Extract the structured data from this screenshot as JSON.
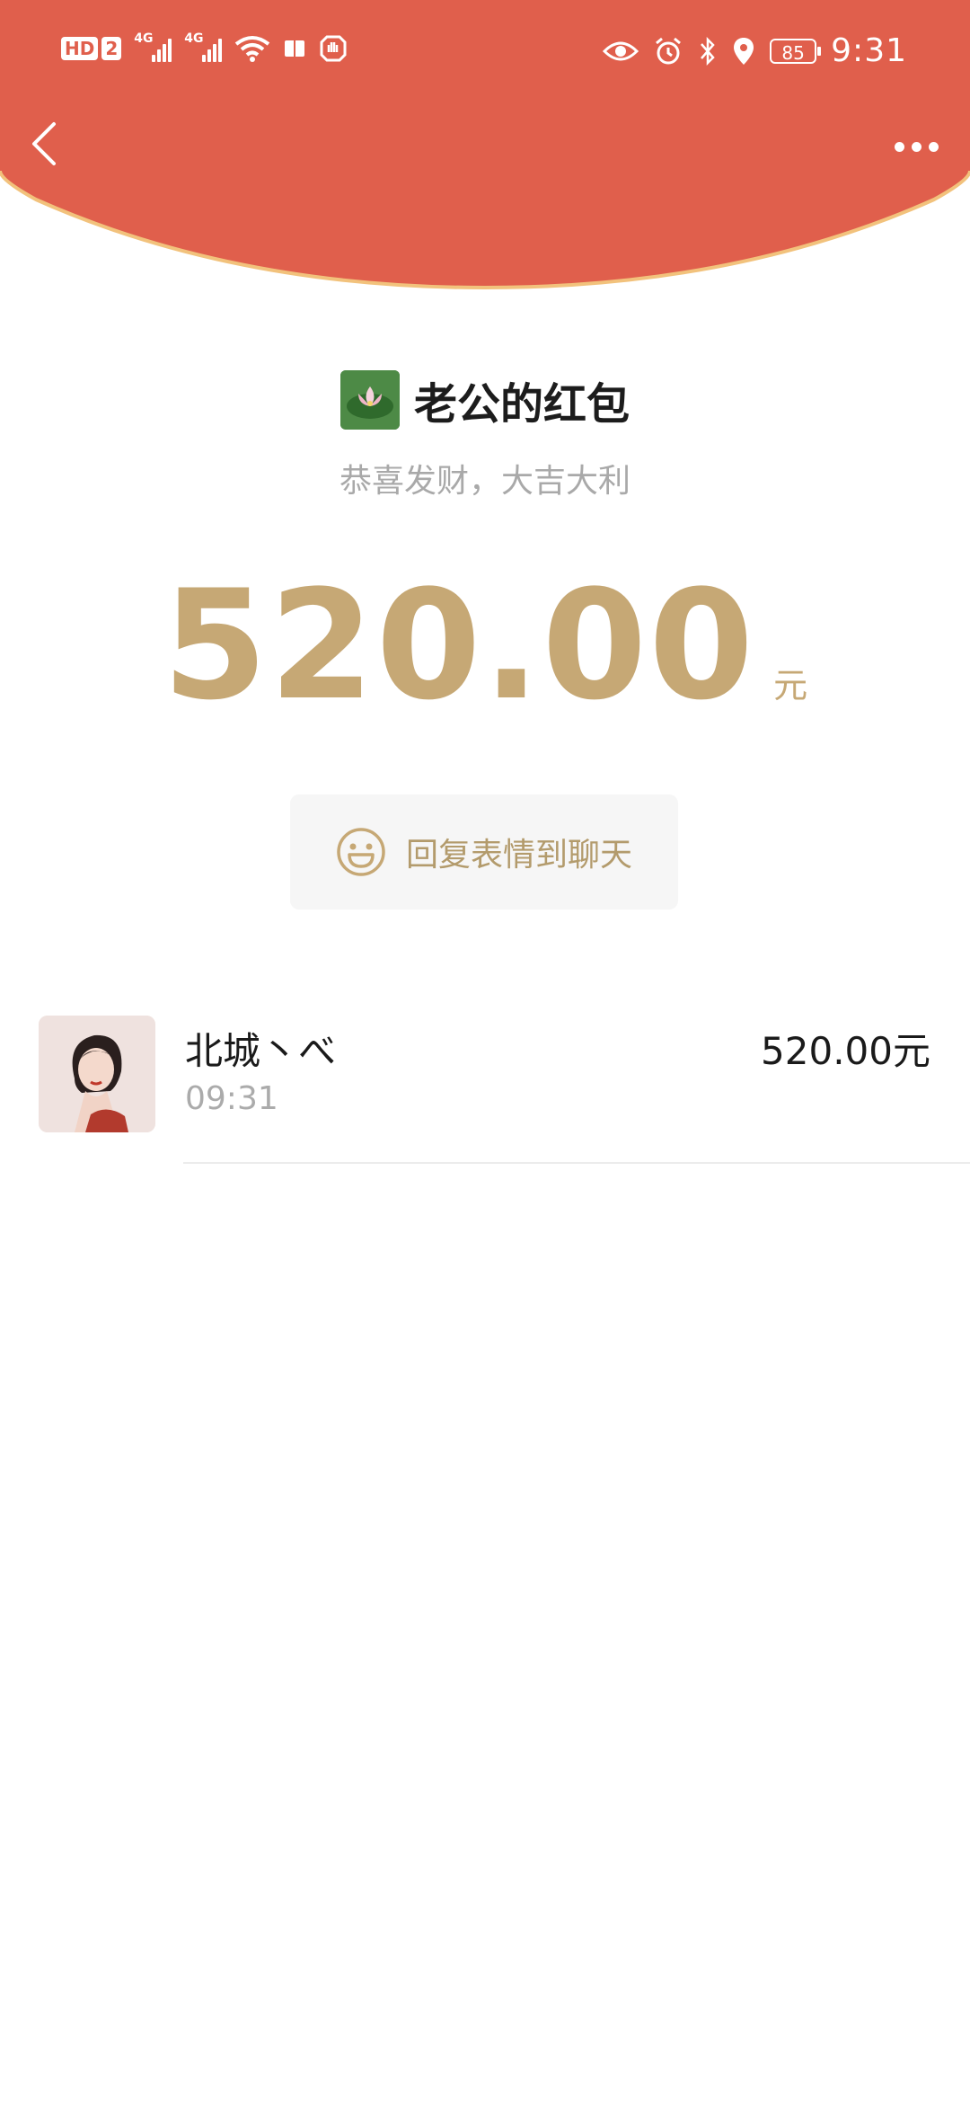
{
  "status_bar": {
    "hd_label": "HD",
    "sim_label": "2",
    "net_type_1": "4G",
    "net_type_2": "4G",
    "battery": "85",
    "time": "9:31"
  },
  "packet": {
    "sender_title": "老公的红包",
    "blessing": "恭喜发财，大吉大利",
    "amount": "520.00",
    "unit": "元",
    "reply_label": "回复表情到聊天"
  },
  "receivers": [
    {
      "name": "北城丶べ",
      "time": "09:31",
      "amount": "520.00元"
    }
  ],
  "colors": {
    "header_red": "#e05f4c",
    "gold": "#c6a875"
  },
  "icons": {
    "back": "back-arrow-icon",
    "more": "more-dots-icon",
    "reply": "smiley-icon"
  }
}
